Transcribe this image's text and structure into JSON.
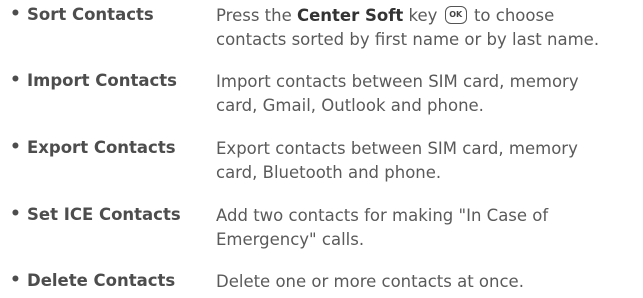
{
  "items": [
    {
      "bullet": "•",
      "term": "Sort Contacts",
      "desc": {
        "pre": "Press the",
        "key_name": "Center Soft",
        "post_key_word": "key",
        "key_icon_text": "OK",
        "after_icon": "to choose",
        "line2": "contacts sorted by first name or by last name."
      }
    },
    {
      "bullet": "•",
      "term": "Import Contacts",
      "desc": {
        "line1": "Import contacts between SIM card, memory",
        "line2": "card, Gmail, Outlook and phone."
      }
    },
    {
      "bullet": "•",
      "term": "Export Contacts",
      "desc": {
        "line1": "Export contacts between SIM card, memory",
        "line2": "card, Bluetooth and phone."
      }
    },
    {
      "bullet": "•",
      "term": "Set ICE Contacts",
      "desc": {
        "line1": "Add two contacts for making \"In Case of",
        "line2": "Emergency\" calls."
      }
    },
    {
      "bullet": "•",
      "term": "Delete Contacts",
      "desc": {
        "line1": "Delete one or more contacts at once."
      }
    }
  ]
}
